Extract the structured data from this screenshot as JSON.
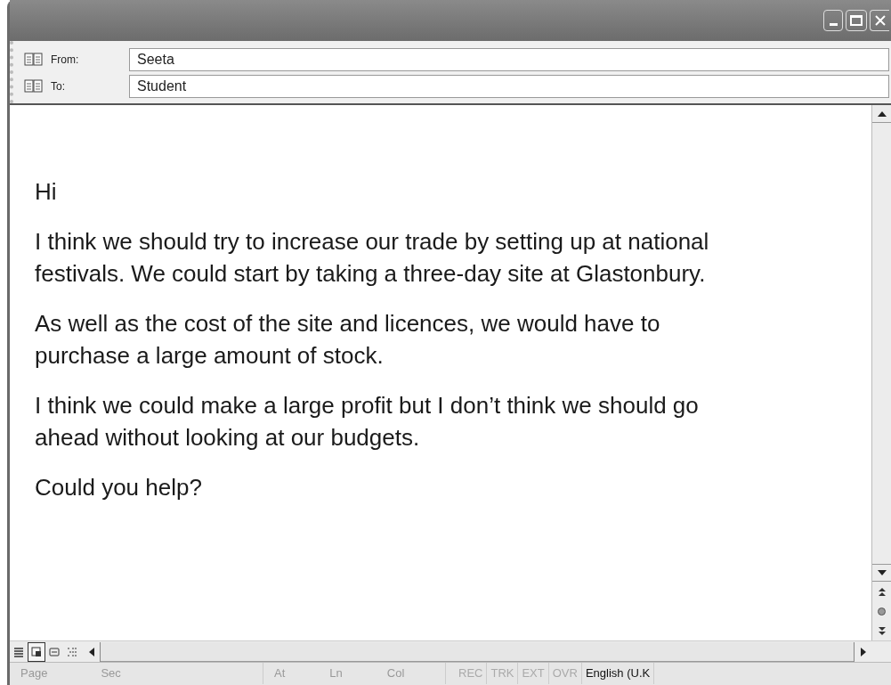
{
  "header": {
    "fields": [
      {
        "label": "From:",
        "value": "Seeta"
      },
      {
        "label": "To:",
        "value": "Student"
      }
    ]
  },
  "message": {
    "paragraphs": [
      "Hi",
      "I think we should try to increase our trade by setting up at national festivals. We could start by taking a three-day site at Glastonbury.",
      "As well as the cost of the site and licences, we would have to purchase a large amount of stock.",
      "I think we could make a large profit but I don’t think we should go ahead without looking at our budgets.",
      "Could you help?"
    ]
  },
  "view_buttons": [
    {
      "kind": "normal",
      "selected": false
    },
    {
      "kind": "print",
      "selected": true
    },
    {
      "kind": "web",
      "selected": false
    },
    {
      "kind": "outline",
      "selected": false
    }
  ],
  "status_bar": {
    "position": [
      "Page",
      "Sec"
    ],
    "cursor": [
      "At",
      "Ln",
      "Col"
    ],
    "indicators": [
      {
        "label": "REC",
        "active": false
      },
      {
        "label": "TRK",
        "active": false
      },
      {
        "label": "EXT",
        "active": false
      },
      {
        "label": "OVR",
        "active": false
      },
      {
        "label": "English (U.K",
        "active": true
      }
    ]
  }
}
